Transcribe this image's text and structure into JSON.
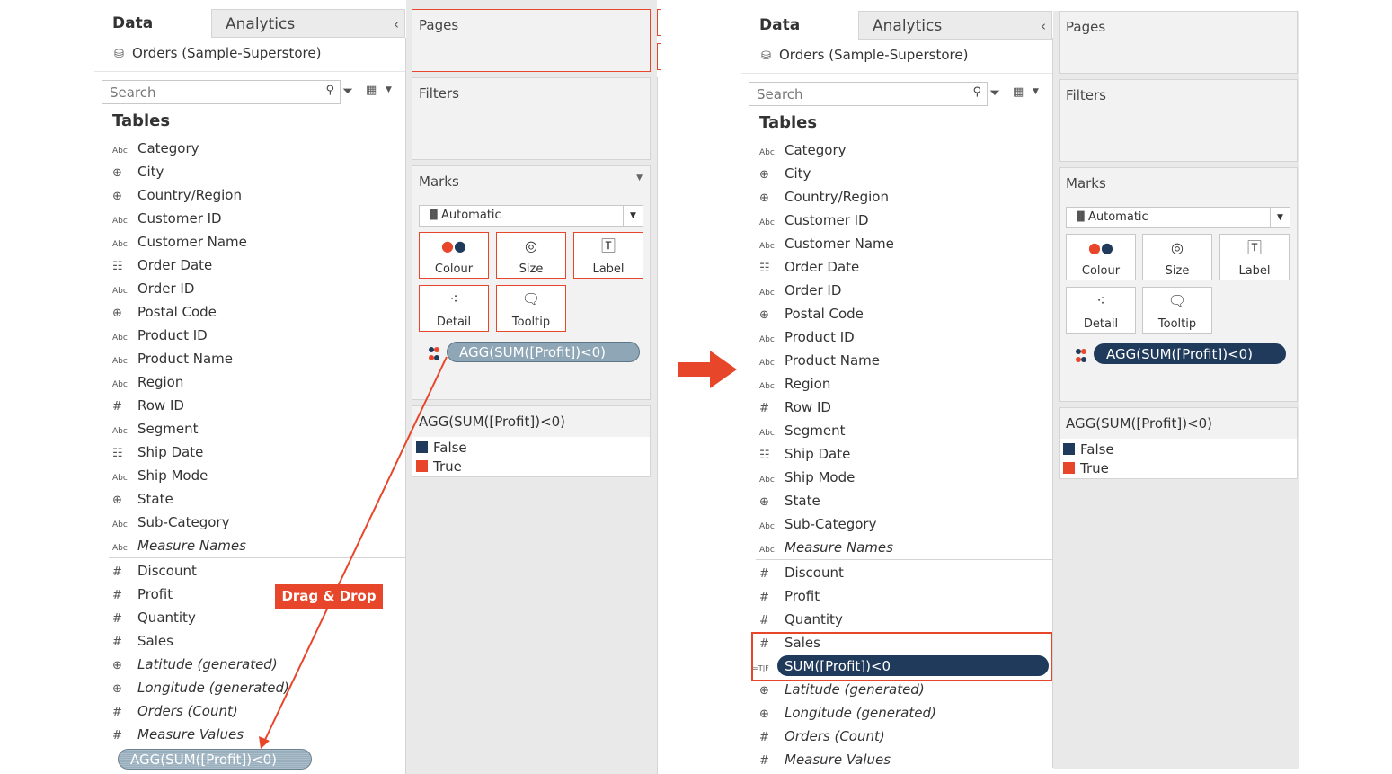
{
  "colors": {
    "accent": "#e8462a",
    "false_color": "#1f3a5b",
    "true_color": "#e8462a",
    "pill_light": "#8ea6b6"
  },
  "tabs": {
    "data": "Data",
    "analytics": "Analytics"
  },
  "source": "Orders (Sample-Superstore)",
  "search": {
    "placeholder": "Search"
  },
  "tables_heading": "Tables",
  "dimensions": [
    {
      "icon": "abc-icon",
      "glyph": "Abc",
      "label": "Category"
    },
    {
      "icon": "globe-icon",
      "glyph": "⊕",
      "label": "City"
    },
    {
      "icon": "globe-icon",
      "glyph": "⊕",
      "label": "Country/Region"
    },
    {
      "icon": "abc-icon",
      "glyph": "Abc",
      "label": "Customer ID"
    },
    {
      "icon": "abc-icon",
      "glyph": "Abc",
      "label": "Customer Name"
    },
    {
      "icon": "calendar-icon",
      "glyph": "☷",
      "label": "Order Date"
    },
    {
      "icon": "abc-icon",
      "glyph": "Abc",
      "label": "Order ID"
    },
    {
      "icon": "globe-icon",
      "glyph": "⊕",
      "label": "Postal Code"
    },
    {
      "icon": "abc-icon",
      "glyph": "Abc",
      "label": "Product ID"
    },
    {
      "icon": "abc-icon",
      "glyph": "Abc",
      "label": "Product Name"
    },
    {
      "icon": "abc-icon",
      "glyph": "Abc",
      "label": "Region"
    },
    {
      "icon": "hash-icon",
      "glyph": "#",
      "label": "Row ID"
    },
    {
      "icon": "abc-icon",
      "glyph": "Abc",
      "label": "Segment"
    },
    {
      "icon": "calendar-icon",
      "glyph": "☷",
      "label": "Ship Date"
    },
    {
      "icon": "abc-icon",
      "glyph": "Abc",
      "label": "Ship Mode"
    },
    {
      "icon": "globe-icon",
      "glyph": "⊕",
      "label": "State"
    },
    {
      "icon": "abc-icon",
      "glyph": "Abc",
      "label": "Sub-Category"
    },
    {
      "icon": "abc-icon",
      "glyph": "Abc",
      "label": "Measure Names"
    }
  ],
  "measures_left": [
    {
      "icon": "hash-icon",
      "glyph": "#",
      "label": "Discount"
    },
    {
      "icon": "hash-icon",
      "glyph": "#",
      "label": "Profit"
    },
    {
      "icon": "hash-icon",
      "glyph": "#",
      "label": "Quantity"
    },
    {
      "icon": "hash-icon",
      "glyph": "#",
      "label": "Sales"
    },
    {
      "icon": "globe-icon",
      "glyph": "⊕",
      "label": "Latitude (generated)"
    },
    {
      "icon": "globe-icon",
      "glyph": "⊕",
      "label": "Longitude (generated)"
    },
    {
      "icon": "hash-icon",
      "glyph": "#",
      "label": "Orders (Count)"
    },
    {
      "icon": "hash-icon",
      "glyph": "#",
      "label": "Measure Values"
    }
  ],
  "measures_right": [
    {
      "icon": "hash-icon",
      "glyph": "#",
      "label": "Discount"
    },
    {
      "icon": "hash-icon",
      "glyph": "#",
      "label": "Profit"
    },
    {
      "icon": "hash-icon",
      "glyph": "#",
      "label": "Quantity"
    },
    {
      "icon": "hash-icon",
      "glyph": "#",
      "label": "Sales"
    },
    {
      "icon": "calc-boolean-icon",
      "glyph": "=T|F",
      "label": "SUM([Profit])<0",
      "pill": true
    },
    {
      "icon": "globe-icon",
      "glyph": "⊕",
      "label": "Latitude (generated)"
    },
    {
      "icon": "globe-icon",
      "glyph": "⊕",
      "label": "Longitude (generated)"
    },
    {
      "icon": "hash-icon",
      "glyph": "#",
      "label": "Orders (Count)"
    },
    {
      "icon": "hash-icon",
      "glyph": "#",
      "label": "Measure Values"
    }
  ],
  "cards": {
    "pages": "Pages",
    "filters": "Filters",
    "marks": "Marks"
  },
  "mark_type": "Automatic",
  "mark_buttons": {
    "colour": "Colour",
    "size": "Size",
    "label": "Label",
    "detail": "Detail",
    "tooltip": "Tooltip"
  },
  "pill_text": "AGG(SUM([Profit])<0)",
  "legend": {
    "title": "AGG(SUM([Profit])<0)",
    "items": [
      "False",
      "True"
    ]
  },
  "callout": "Drag & Drop"
}
